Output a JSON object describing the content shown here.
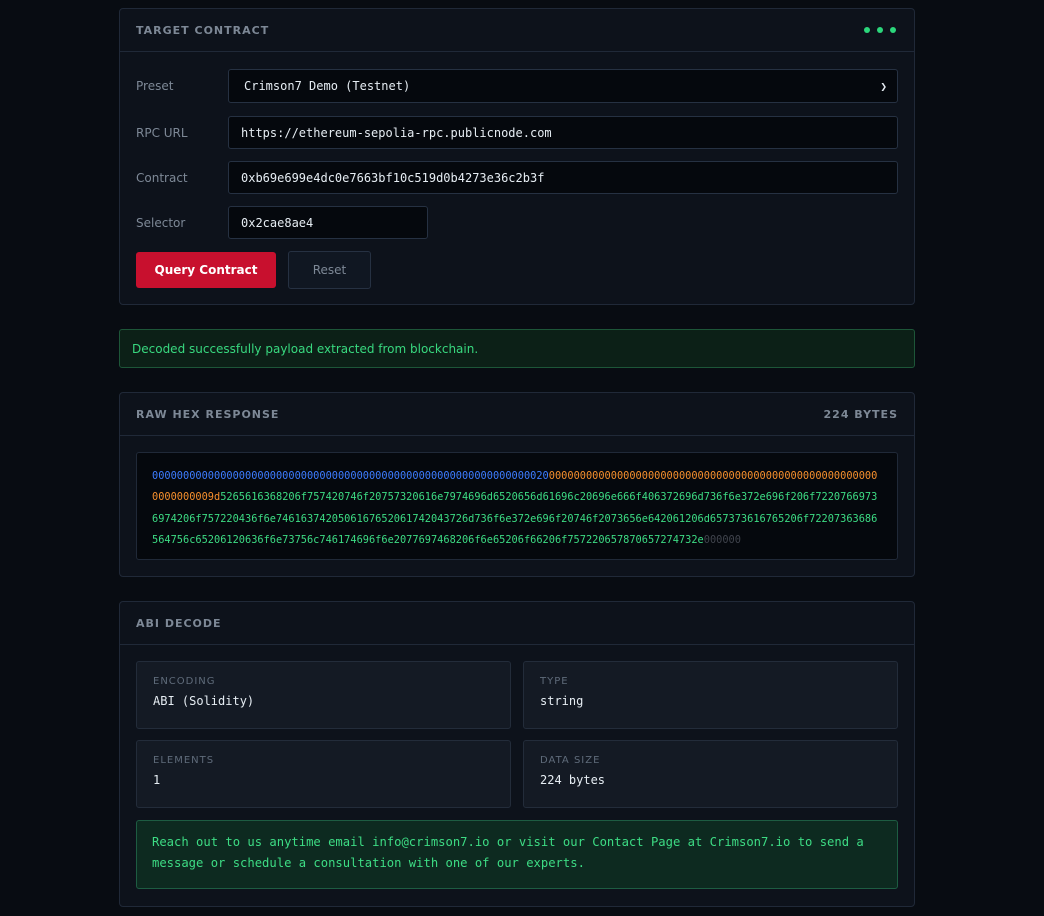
{
  "target": {
    "title": "TARGET CONTRACT",
    "preset_label": "Preset",
    "preset_value": "Crimson7 Demo (Testnet)",
    "rpc_label": "RPC URL",
    "rpc_value": "https://ethereum-sepolia-rpc.publicnode.com",
    "contract_label": "Contract",
    "contract_value": "0xb69e699e4dc0e7663bf10c519d0b4273e36c2b3f",
    "selector_label": "Selector",
    "selector_value": "0x2cae8ae4",
    "query_label": "Query Contract",
    "reset_label": "Reset"
  },
  "status": {
    "message": "Decoded successfully payload extracted from blockchain."
  },
  "raw": {
    "title": "RAW HEX RESPONSE",
    "bytes": "224 BYTES",
    "offset": "0000000000000000000000000000000000000000000000000000000000000020",
    "length": "000000000000000000000000000000000000000000000000000000000000009d",
    "data": "5265616368206f757420746f20757320616e7974696d6520656d61696c20696e666f406372696d736f6e372e696f206f72207669736974206f757220436f6e7461637420506167652061742043726d736f6e372e696f20746f2073656e642061206d657373616765206f72207363686564756c65206120636f6e73756c746174696f6e2077697468206f6e65206f66206f75722065787065727473",
    "data_tail": "2e",
    "padding": "000000"
  },
  "abi": {
    "title": "ABI DECODE",
    "encoding_label": "ENCODING",
    "encoding_value": "ABI (Solidity)",
    "type_label": "TYPE",
    "type_value": "string",
    "elements_label": "ELEMENTS",
    "elements_value": "1",
    "size_label": "DATA SIZE",
    "size_value": "224 bytes",
    "decoded_message": "Reach out to us anytime email info@crimson7.io or visit our Contact Page at Crimson7.io to send a message or schedule a consultation with one of our experts."
  },
  "colors": {
    "accent": "#c8102e",
    "success": "#3ddc84",
    "offset": "#3d7cff",
    "length": "#f58f2d"
  }
}
